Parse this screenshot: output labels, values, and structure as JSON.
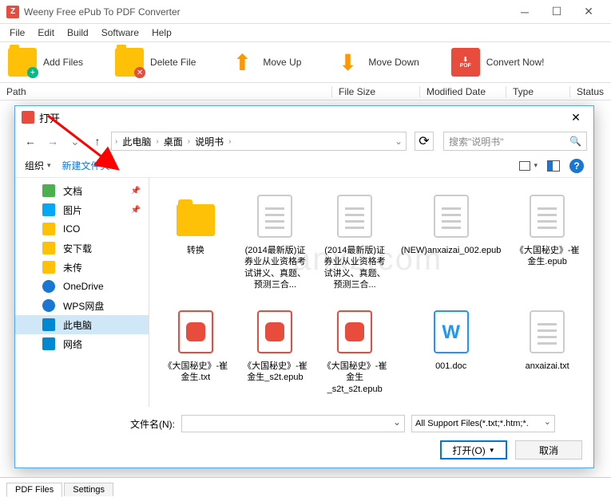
{
  "window": {
    "title": "Weeny Free ePub To PDF Converter",
    "app_icon": "Z"
  },
  "menu": [
    "File",
    "Edit",
    "Build",
    "Software",
    "Help"
  ],
  "toolbar": {
    "add": "Add Files",
    "delete": "Delete File",
    "up": "Move Up",
    "down": "Move Down",
    "convert": "Convert Now!"
  },
  "columns": {
    "path": "Path",
    "size": "File Size",
    "modified": "Modified Date",
    "type": "Type",
    "status": "Status"
  },
  "dialog": {
    "title": "打开",
    "breadcrumb": [
      "此电脑",
      "桌面",
      "说明书"
    ],
    "search_placeholder": "搜索\"说明书\"",
    "organize": "组织",
    "new_folder": "新建文件夹",
    "sidebar": [
      {
        "label": "文档",
        "icon": "doc",
        "pin": true
      },
      {
        "label": "图片",
        "icon": "pic",
        "pin": true
      },
      {
        "label": "ICO",
        "icon": "fld"
      },
      {
        "label": "安下载",
        "icon": "fld"
      },
      {
        "label": "未传",
        "icon": "fld"
      },
      {
        "label": "OneDrive",
        "icon": "cloud"
      },
      {
        "label": "WPS网盘",
        "icon": "cloud"
      },
      {
        "label": "此电脑",
        "icon": "pc",
        "selected": true
      },
      {
        "label": "网络",
        "icon": "net"
      }
    ],
    "files": [
      {
        "name": "转换",
        "type": "folder"
      },
      {
        "name": "(2014最新版)证券业从业资格考试讲义、真题、预测三合...",
        "type": "txt"
      },
      {
        "name": "(2014最新版)证券业从业资格考试讲义、真题、预测三合...",
        "type": "txt"
      },
      {
        "name": "(NEW)anxaizai_002.epub",
        "type": "txt"
      },
      {
        "name": "《大国秘史》-崔金生.epub",
        "type": "txt"
      },
      {
        "name": "《大国秘史》-崔金生.txt",
        "type": "epub"
      },
      {
        "name": "《大国秘史》-崔金生_s2t.epub",
        "type": "epub"
      },
      {
        "name": "《大国秘史》-崔金生_s2t_s2t.epub",
        "type": "epub"
      },
      {
        "name": "001.doc",
        "type": "doc"
      },
      {
        "name": "anxaizai.txt",
        "type": "txt"
      }
    ],
    "filename_label": "文件名(N):",
    "filter": "All Support Files(*.txt;*.htm;*.",
    "open_btn": "打开(O)",
    "cancel_btn": "取消",
    "watermark": "anxz.com"
  },
  "tabs": [
    "PDF Files",
    "Settings"
  ]
}
